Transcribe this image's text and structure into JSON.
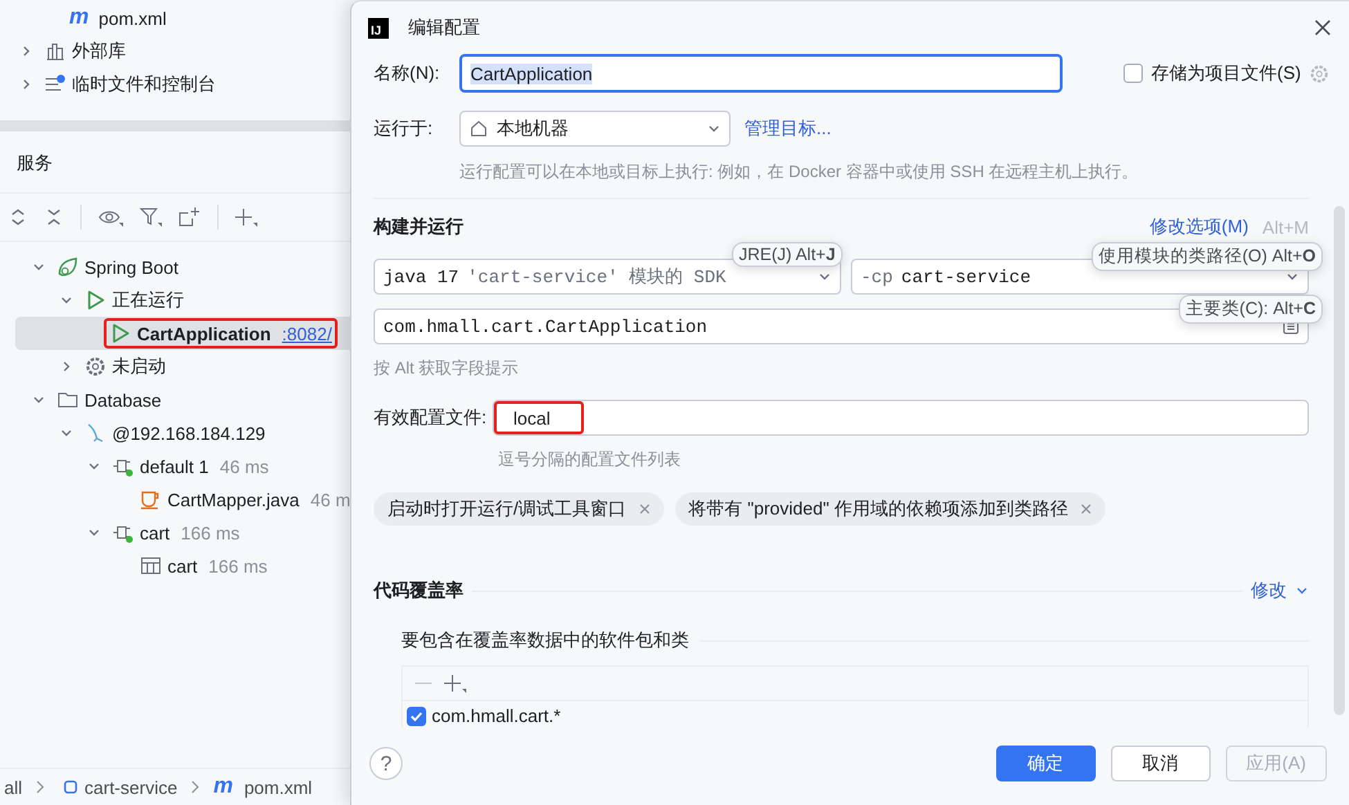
{
  "project_tree": [
    {
      "label": "pom.xml",
      "kind": "maven",
      "glyph": "m"
    },
    {
      "label": "外部库",
      "kind": "library",
      "expanded": false
    },
    {
      "label": "临时文件和控制台",
      "kind": "scratch",
      "expanded": false
    }
  ],
  "services": {
    "title": "服务",
    "tree": [
      {
        "label": "Spring Boot",
        "kind": "springboot",
        "expanded": true,
        "selected": false,
        "children": [
          {
            "label": "正在运行",
            "kind": "running",
            "expanded": true,
            "selected": false,
            "children": [
              {
                "label": "CartApplication",
                "link": ":8082/",
                "kind": "app",
                "selected": true,
                "highlighted": true
              }
            ]
          },
          {
            "label": "未启动",
            "kind": "gear",
            "expanded": false,
            "selected": false
          }
        ]
      },
      {
        "label": "Database",
        "kind": "folder",
        "expanded": true,
        "selected": false,
        "children": [
          {
            "label": "@192.168.184.129",
            "kind": "mysql",
            "expanded": true,
            "selected": false,
            "children": [
              {
                "label": "default 1",
                "detail": "46 ms",
                "kind": "connection",
                "expanded": true,
                "selected": false,
                "children": [
                  {
                    "label": "CartMapper.java",
                    "detail": "46 m",
                    "kind": "java",
                    "selected": false
                  }
                ]
              },
              {
                "label": "cart",
                "detail": "166 ms",
                "kind": "connection",
                "expanded": true,
                "selected": false,
                "children": [
                  {
                    "label": "cart",
                    "detail": "166 ms",
                    "kind": "table",
                    "selected": false
                  }
                ]
              }
            ]
          }
        ]
      }
    ]
  },
  "breadcrumb": [
    {
      "label": "all",
      "kind": "text"
    },
    {
      "label": "cart-service",
      "kind": "module"
    },
    {
      "label": "pom.xml",
      "kind": "maven",
      "glyph": "m"
    }
  ],
  "dialog": {
    "title": "编辑配置",
    "logo": "IJ",
    "name": {
      "label": "名称(N):",
      "value": "CartApplication",
      "text_selected": true
    },
    "store_as_file": {
      "label": "存储为项目文件(S)",
      "checked": false
    },
    "run_on": {
      "label": "运行于:",
      "value": "本地机器",
      "link": "管理目标...",
      "hint": "运行配置可以在本地或目标上执行: 例如，在 Docker 容器中或使用 SSH 在远程主机上执行。"
    },
    "build": {
      "title": "构建并运行",
      "modify_options": "修改选项(M)",
      "modify_shortcut": "Alt+M",
      "jre": {
        "value": "java 17",
        "detail": "'cart-service' 模块的 SDK"
      },
      "classpath": {
        "flag": "-cp",
        "value": "cart-service"
      },
      "main_class": "com.hmall.cart.CartApplication",
      "hint": "按 Alt 获取字段提示",
      "tooltips": [
        "JRE(J) Alt+**J**",
        "使用模块的类路径(O) Alt+**O**",
        "主要类(C): Alt+**C**"
      ]
    },
    "profiles": {
      "label": "有效配置文件:",
      "value": "local",
      "highlighted": true,
      "hint": "逗号分隔的配置文件列表"
    },
    "chips": [
      "启动时打开运行/调试工具窗口",
      "将带有 \"provided\" 作用域的依赖项添加到类路径"
    ],
    "coverage": {
      "title": "代码覆盖率",
      "modify": "修改",
      "subtitle": "要包含在覆盖率数据中的软件包和类",
      "entries": [
        {
          "label": "com.hmall.cart.*",
          "checked": true
        }
      ]
    },
    "help": "?",
    "buttons": [
      {
        "label": "确定",
        "kind": "primary",
        "disabled": false
      },
      {
        "label": "取消",
        "kind": "default",
        "disabled": false
      },
      {
        "label": "应用(A)",
        "kind": "default",
        "disabled": true
      }
    ]
  }
}
